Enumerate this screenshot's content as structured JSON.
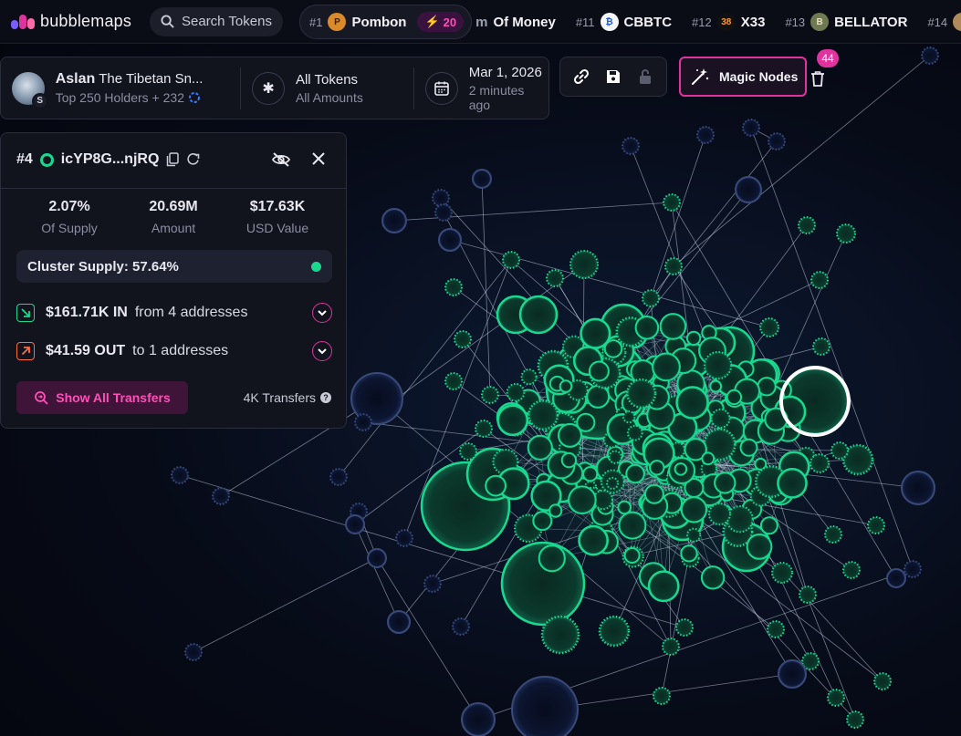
{
  "brand": {
    "name": "bubblemaps"
  },
  "search": {
    "label": "Search Tokens"
  },
  "trending": [
    {
      "rank": "#1",
      "name": "Pombon",
      "boost": "20",
      "coin_color": "#d98a2b",
      "coin_glyph": "P"
    },
    {
      "rank": "",
      "name": "Of Money",
      "partial_prefix": "m"
    },
    {
      "rank": "#11",
      "name": "CBBTC",
      "coin_color": "#f4f6fb",
      "coin_glyph": "₿"
    },
    {
      "rank": "#12",
      "name": "X33",
      "coin_color": "#111111",
      "coin_glyph": "38"
    },
    {
      "rank": "#13",
      "name": "BELLATOR",
      "coin_color": "#6f7a52",
      "coin_glyph": "B"
    },
    {
      "rank": "#14",
      "name": "",
      "coin_color": "#b08a5a",
      "coin_glyph": ""
    }
  ],
  "token": {
    "name": "Aslan",
    "full_name": "The Tibetan Sn...",
    "holders": "Top 250 Holders + 232",
    "chain_badge": "S"
  },
  "filter": {
    "title": "All Tokens",
    "subtitle": "All Amounts"
  },
  "date": {
    "value": "Mar 1, 2026",
    "relative": "2 minutes ago"
  },
  "toolbar": {
    "magic_label": "Magic Nodes",
    "magic_badge": "44"
  },
  "wallet": {
    "rank": "#4",
    "address": "icYP8G...njRQ",
    "stats": [
      {
        "value": "2.07%",
        "label": "Of Supply"
      },
      {
        "value": "20.69M",
        "label": "Amount"
      },
      {
        "value": "$17.63K",
        "label": "USD Value"
      }
    ],
    "cluster_supply": "Cluster Supply: 57.64%",
    "inflow": {
      "amount": "$161.71K IN",
      "desc": "from 4 addresses"
    },
    "outflow": {
      "amount": "$41.59 OUT",
      "desc": "to 1 addresses"
    },
    "show_transfers_label": "Show All Transfers",
    "transfers_count": "4K Transfers"
  },
  "colors": {
    "accent_pink": "#e0339e",
    "node_green": "#19d88f",
    "node_blue": "#2a3a66",
    "in_green": "#19d88f",
    "out_orange": "#ff6b3d"
  }
}
